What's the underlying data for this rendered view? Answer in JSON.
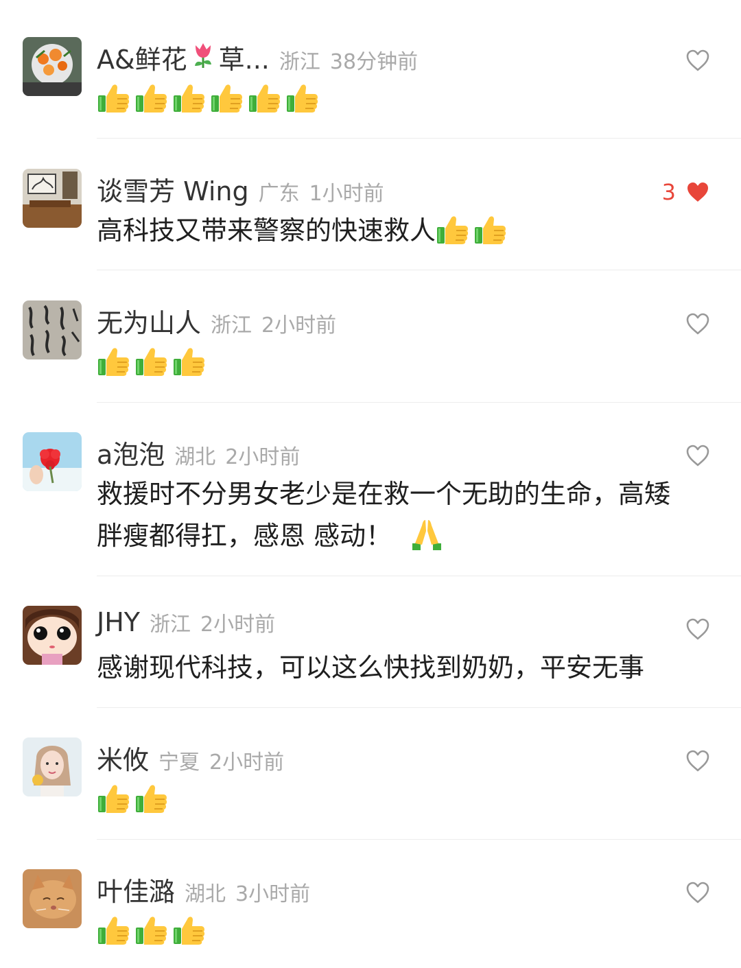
{
  "comments": [
    {
      "name": "A&鲜花",
      "name_tail": "草...",
      "location": "浙江",
      "time": "38分钟前",
      "text": "",
      "thumbs": 6,
      "liked": false,
      "like_count": "",
      "avatar": "bouquet-avatar"
    },
    {
      "name": "谈雪芳 Wing",
      "location": "广东",
      "time": "1小时前",
      "text": "高科技又带来警察的快速救人",
      "thumbs": 2,
      "liked": true,
      "like_count": "3",
      "avatar": "room-avatar"
    },
    {
      "name": "无为山人",
      "location": "浙江",
      "time": "2小时前",
      "text": "",
      "thumbs": 3,
      "liked": false,
      "like_count": "",
      "avatar": "calligraphy-avatar"
    },
    {
      "name": "a泡泡",
      "location": "湖北",
      "time": "2小时前",
      "text_line1": "救援时不分男女老少是在救一个无助的生命，高矮",
      "text_line2": "胖瘦都得扛，感恩 感动！",
      "thumbs": 0,
      "pray": true,
      "liked": false,
      "like_count": "",
      "avatar": "flower-avatar"
    },
    {
      "name": "JHY",
      "location": "浙江",
      "time": "2小时前",
      "text": "感谢现代科技，可以这么快找到奶奶，平安无事",
      "thumbs": 0,
      "liked": false,
      "like_count": "",
      "avatar": "cartoon-girl-avatar"
    },
    {
      "name": "米攸",
      "location": "宁夏",
      "time": "2小时前",
      "text": "",
      "thumbs": 2,
      "liked": false,
      "like_count": "",
      "avatar": "portrait-avatar"
    },
    {
      "name": "叶佳潞",
      "location": "湖北",
      "time": "3小时前",
      "text": "",
      "thumbs": 3,
      "liked": false,
      "like_count": "",
      "avatar": "cat-avatar"
    }
  ],
  "colors": {
    "liked": "#e8463a",
    "meta": "#a9a9a9",
    "name": "#333333",
    "text": "#1f1f1f"
  }
}
